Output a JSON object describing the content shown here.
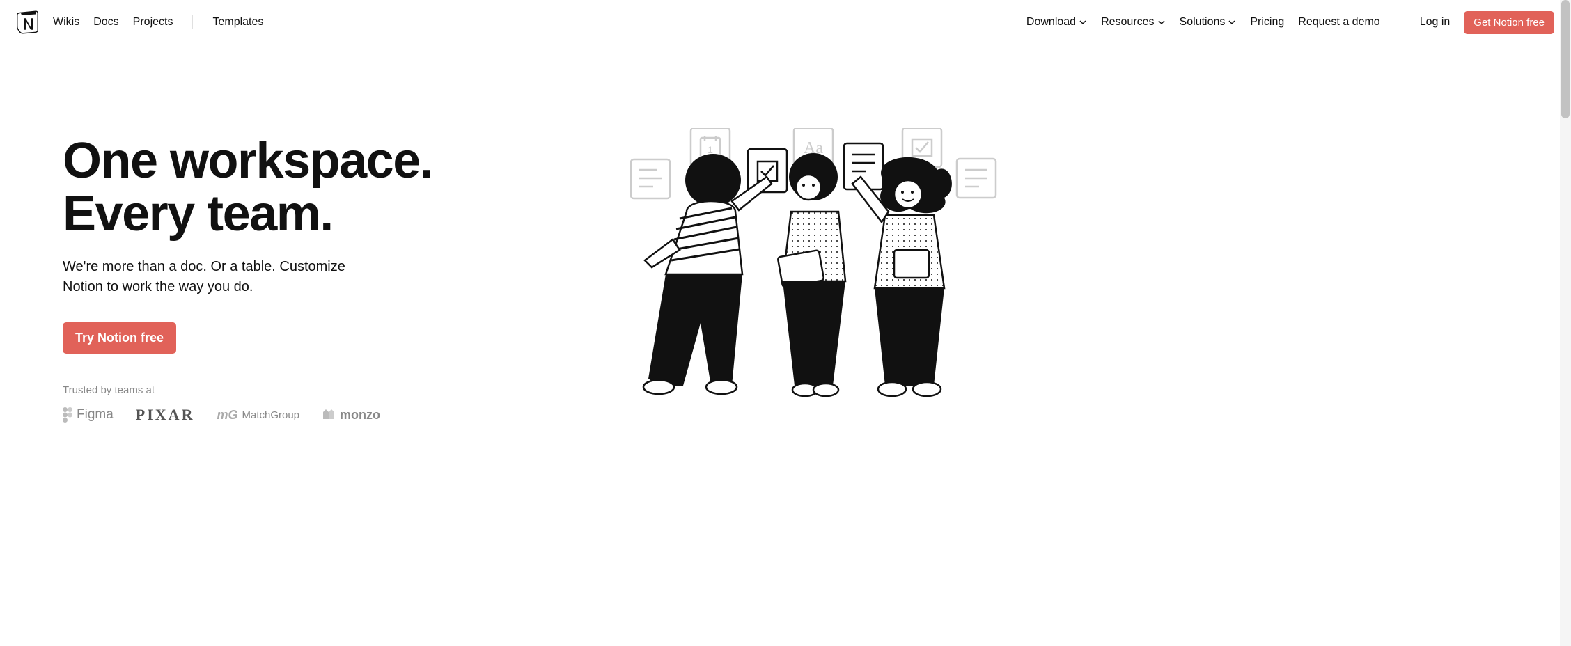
{
  "header": {
    "nav_left": {
      "wikis": "Wikis",
      "docs": "Docs",
      "projects": "Projects",
      "templates": "Templates"
    },
    "nav_right": {
      "download": "Download",
      "resources": "Resources",
      "solutions": "Solutions",
      "pricing": "Pricing",
      "request_demo": "Request a demo",
      "login": "Log in",
      "cta": "Get Notion free"
    }
  },
  "hero": {
    "title_line1": "One workspace.",
    "title_line2": "Every team.",
    "subtitle": "We're more than a doc. Or a table. Customize Notion to work the way you do.",
    "cta": "Try Notion free",
    "trusted_label": "Trusted by teams at",
    "companies": {
      "figma": "Figma",
      "pixar": "PIXAR",
      "match": "MatchGroup",
      "monzo": "monzo"
    }
  }
}
